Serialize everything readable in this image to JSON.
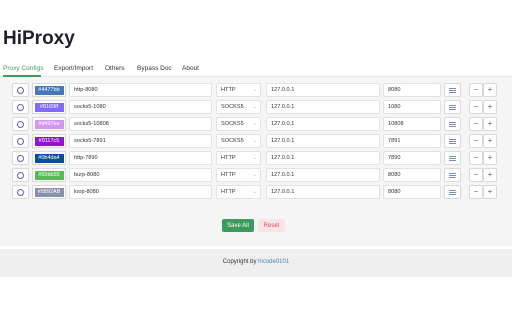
{
  "app": {
    "title": "HiProxy"
  },
  "tabs": [
    {
      "label": "Proxy Configs",
      "active": true
    },
    {
      "label": "Export/Import",
      "active": false
    },
    {
      "label": "Others",
      "active": false
    },
    {
      "label": "Bypass Doc",
      "active": false
    },
    {
      "label": "About",
      "active": false
    }
  ],
  "accent_color": "#3c9a5f",
  "proxies": [
    {
      "color": "#4477bb",
      "name": "http-8080",
      "protocol": "HTTP",
      "host": "127.0.0.1",
      "port": "8080"
    },
    {
      "color": "#8169ff",
      "name": "socks5-1080",
      "protocol": "SOCKS5",
      "host": "127.0.0.1",
      "port": "1080"
    },
    {
      "color": "#d497ee",
      "name": "socks5-10808",
      "protocol": "SOCKS5",
      "host": "127.0.0.1",
      "port": "10808"
    },
    {
      "color": "#9117c5",
      "name": "socks5-7891",
      "protocol": "SOCKS5",
      "host": "127.0.0.1",
      "port": "7891"
    },
    {
      "color": "#0b4da4",
      "name": "http-7890",
      "protocol": "HTTP",
      "host": "127.0.0.1",
      "port": "7890"
    },
    {
      "color": "#55bb55",
      "name": "burp-8080",
      "protocol": "HTTP",
      "host": "127.0.0.1",
      "port": "8080"
    },
    {
      "color": "#8892AB",
      "name": "loop-8080",
      "protocol": "HTTP",
      "host": "127.0.0.1",
      "port": "8080"
    }
  ],
  "actions": {
    "save_label": "Save All",
    "reset_label": "Reset"
  },
  "footer": {
    "prefix": "Copyright by ",
    "author": "hicode0101"
  },
  "icons": {
    "radio": "radio-icon",
    "settings": "lines-settings-icon",
    "minus": "minus-icon",
    "plus": "plus-icon",
    "chevron": "chevron-down-icon"
  }
}
